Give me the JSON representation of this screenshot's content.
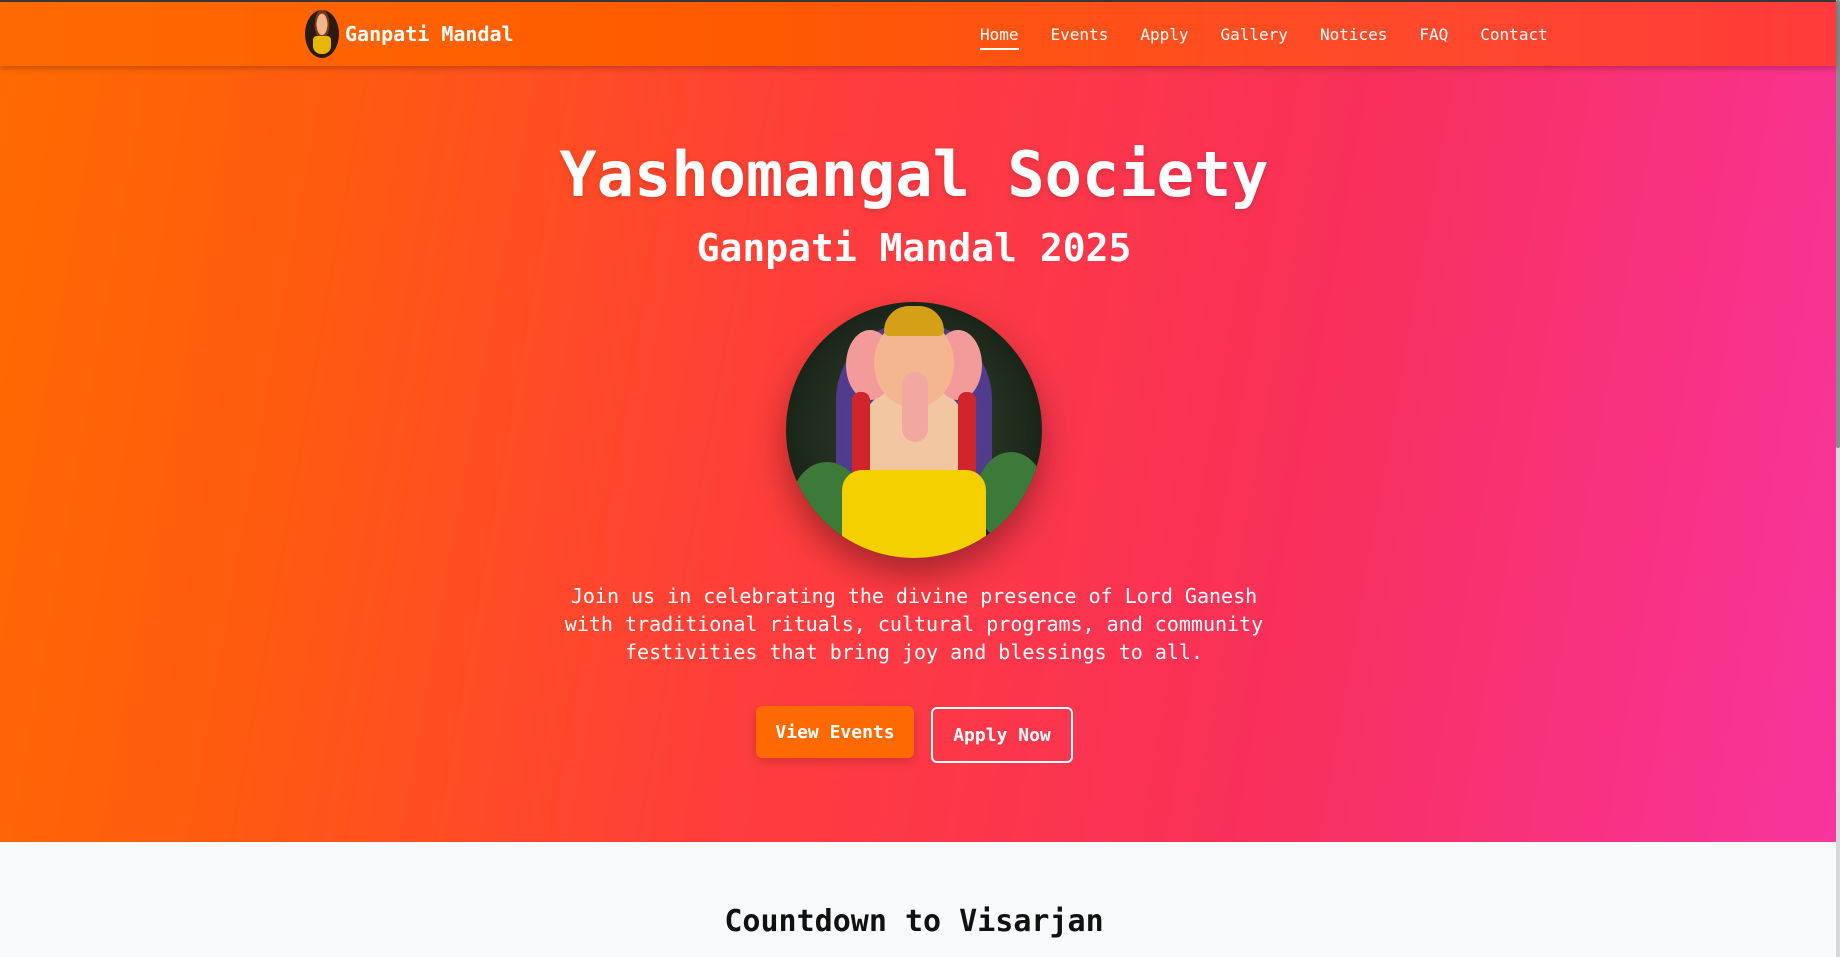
{
  "navbar": {
    "brand": "Ganpati Mandal",
    "links": [
      "Home",
      "Events",
      "Apply",
      "Gallery",
      "Notices",
      "FAQ",
      "Contact"
    ],
    "active": "Home"
  },
  "hero": {
    "title": "Yashomangal Society",
    "subtitle": "Ganpati Mandal 2025",
    "description": "Join us in celebrating the divine presence of Lord Ganesh with traditional rituals, cultural programs, and community festivities that bring joy and blessings to all.",
    "primary_button": "View Events",
    "secondary_button": "Apply Now"
  },
  "countdown": {
    "title": "Countdown to Visarjan"
  },
  "colors": {
    "accent": "#ff6a00",
    "gradient_start": "#ff6a00",
    "gradient_mid": "#ff3e3a",
    "gradient_end": "#f8349e"
  }
}
